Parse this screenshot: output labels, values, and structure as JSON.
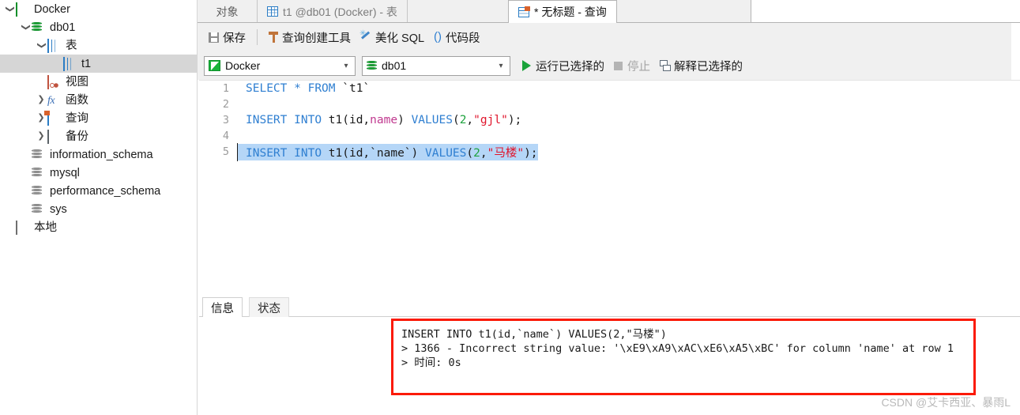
{
  "sidebar": {
    "items": [
      {
        "label": "Docker",
        "icon": "connection-icon",
        "indent": 0,
        "twisty": "expanded",
        "selected": false
      },
      {
        "label": "db01",
        "icon": "database-green-icon",
        "indent": 1,
        "twisty": "expanded",
        "selected": false
      },
      {
        "label": "表",
        "icon": "table-icon",
        "indent": 2,
        "twisty": "expanded",
        "selected": false
      },
      {
        "label": "t1",
        "icon": "table-icon",
        "indent": 3,
        "twisty": "none",
        "selected": true
      },
      {
        "label": "视图",
        "icon": "view-icon",
        "indent": 2,
        "twisty": "none",
        "selected": false
      },
      {
        "label": "函数",
        "icon": "function-fx-icon",
        "indent": 2,
        "twisty": "collapsed",
        "selected": false
      },
      {
        "label": "查询",
        "icon": "query-icon",
        "indent": 2,
        "twisty": "collapsed",
        "selected": false
      },
      {
        "label": "备份",
        "icon": "backup-icon",
        "indent": 2,
        "twisty": "collapsed",
        "selected": false
      },
      {
        "label": "information_schema",
        "icon": "database-gray-icon",
        "indent": 1,
        "twisty": "none",
        "selected": false
      },
      {
        "label": "mysql",
        "icon": "database-gray-icon",
        "indent": 1,
        "twisty": "none",
        "selected": false
      },
      {
        "label": "performance_schema",
        "icon": "database-gray-icon",
        "indent": 1,
        "twisty": "none",
        "selected": false
      },
      {
        "label": "sys",
        "icon": "database-gray-icon",
        "indent": 1,
        "twisty": "none",
        "selected": false
      },
      {
        "label": "本地",
        "icon": "local-icon",
        "indent": 0,
        "twisty": "none",
        "selected": false
      }
    ]
  },
  "tabs": {
    "objects_label": "对象",
    "inactive_tab_label": "t1 @db01 (Docker) - 表",
    "active_tab_label": "* 无标题 - 查询"
  },
  "toolbar": {
    "save_label": "保存",
    "query_builder_label": "查询创建工具",
    "beautify_label": "美化 SQL",
    "snippet_label": "代码段",
    "connection_value": "Docker",
    "database_value": "db01",
    "run_selected_label": "运行已选择的",
    "stop_label": "停止",
    "explain_selected_label": "解释已选择的"
  },
  "editor": {
    "lines": [
      {
        "no": "1",
        "selected": false,
        "tokens": [
          {
            "t": "SELECT",
            "c": "kw"
          },
          {
            "t": " ",
            "c": "id"
          },
          {
            "t": "*",
            "c": "kw"
          },
          {
            "t": " ",
            "c": "id"
          },
          {
            "t": "FROM",
            "c": "kw"
          },
          {
            "t": " ",
            "c": "id"
          },
          {
            "t": "`t1`",
            "c": "id"
          }
        ]
      },
      {
        "no": "2",
        "selected": false,
        "tokens": []
      },
      {
        "no": "3",
        "selected": false,
        "tokens": [
          {
            "t": "INSERT",
            "c": "kw"
          },
          {
            "t": " ",
            "c": "id"
          },
          {
            "t": "INTO",
            "c": "kw"
          },
          {
            "t": " ",
            "c": "id"
          },
          {
            "t": "t1(id,",
            "c": "id"
          },
          {
            "t": "name",
            "c": "pnk"
          },
          {
            "t": ") ",
            "c": "id"
          },
          {
            "t": "VALUES",
            "c": "kw"
          },
          {
            "t": "(",
            "c": "id"
          },
          {
            "t": "2",
            "c": "num"
          },
          {
            "t": ",",
            "c": "id"
          },
          {
            "t": "\"gjl\"",
            "c": "str"
          },
          {
            "t": ");",
            "c": "id"
          }
        ]
      },
      {
        "no": "4",
        "selected": false,
        "tokens": []
      },
      {
        "no": "5",
        "selected": true,
        "tokens": [
          {
            "t": "INSERT",
            "c": "kw"
          },
          {
            "t": " ",
            "c": "id"
          },
          {
            "t": "INTO",
            "c": "kw"
          },
          {
            "t": " ",
            "c": "id"
          },
          {
            "t": "t1(id,`name`) ",
            "c": "id"
          },
          {
            "t": "VALUES",
            "c": "kw"
          },
          {
            "t": "(",
            "c": "id"
          },
          {
            "t": "2",
            "c": "num"
          },
          {
            "t": ",",
            "c": "id"
          },
          {
            "t": "\"马楼\"",
            "c": "str"
          },
          {
            "t": ");",
            "c": "id"
          }
        ]
      }
    ]
  },
  "result": {
    "tab_info_label": "信息",
    "tab_status_label": "状态",
    "message_lines": [
      "INSERT INTO t1(id,`name`) VALUES(2,\"马楼\")",
      "> 1366 - Incorrect string value: '\\xE9\\xA9\\xAC\\xE6\\xA5\\xBC' for column 'name' at row 1",
      "> 时间: 0s"
    ],
    "highlight_border_color": "#fb1a07"
  },
  "watermark": {
    "text": "CSDN @艾卡西亚、暴雨L"
  }
}
